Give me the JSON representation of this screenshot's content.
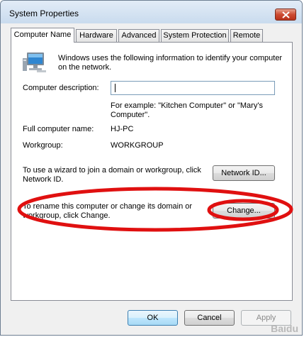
{
  "window": {
    "title": "System Properties",
    "close_label": "Close"
  },
  "tabs": [
    {
      "label": "Computer Name",
      "active": true
    },
    {
      "label": "Hardware",
      "active": false
    },
    {
      "label": "Advanced",
      "active": false
    },
    {
      "label": "System Protection",
      "active": false
    },
    {
      "label": "Remote",
      "active": false
    }
  ],
  "panel": {
    "intro_line1": "Windows uses the following information to identify your computer",
    "intro_line2": "on the network.",
    "description_label": "Computer description:",
    "description_value": "",
    "example_line1": "For example: \"Kitchen Computer\" or \"Mary's",
    "example_line2": "Computer\".",
    "full_name_label": "Full computer name:",
    "full_name_value": "HJ-PC",
    "workgroup_label": "Workgroup:",
    "workgroup_value": "WORKGROUP",
    "network_id_text_line1": "To use a wizard to join a domain or workgroup, click",
    "network_id_text_line2": "Network ID.",
    "network_id_button": "Network ID...",
    "change_text_line1": "To rename this computer or change its domain or",
    "change_text_line2": "workgroup, click Change.",
    "change_button": "Change..."
  },
  "footer": {
    "ok": "OK",
    "cancel": "Cancel",
    "apply": "Apply"
  },
  "watermark": "Baidu",
  "colors": {
    "annotation": "#e01010",
    "title_bar": "#c9dbee",
    "close_button": "#cd4a31",
    "default_button_border": "#3c7fb1"
  }
}
